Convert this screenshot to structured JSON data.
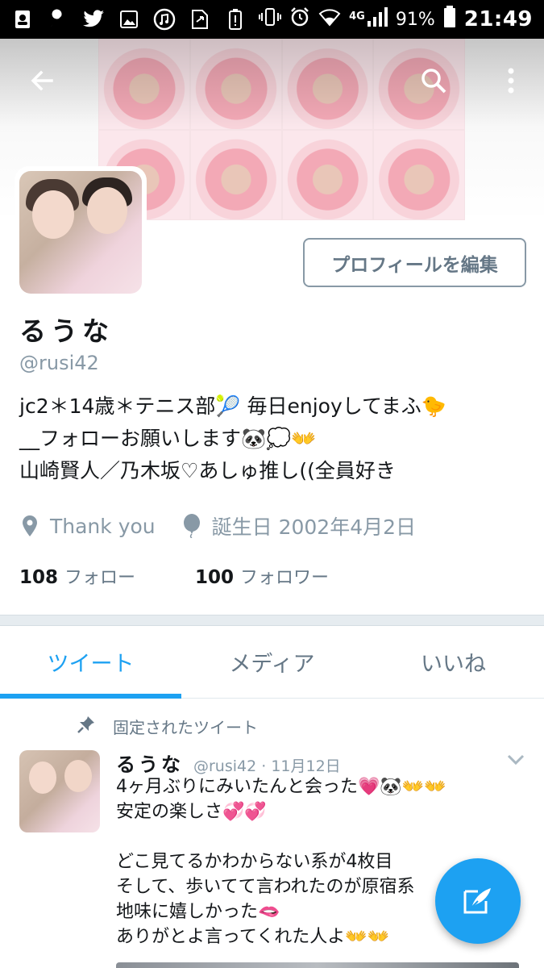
{
  "status_bar": {
    "left_icons": [
      "contacts-icon",
      "wrench-icon",
      "twitter-bird-icon",
      "image-icon",
      "music-icon",
      "file-transfer-icon",
      "battery-alert-icon"
    ],
    "network_label": "4G",
    "battery_percent": "91%",
    "time": "21:49"
  },
  "header": {
    "back_icon": "arrow-back-icon",
    "search_icon": "search-icon",
    "more_icon": "more-vert-icon"
  },
  "profile": {
    "edit_button": "プロフィールを編集",
    "name": "るうな",
    "handle": "@rusi42",
    "bio_lines": [
      "jc2＊14歳＊テニス部🎾 毎日enjoyしてまふ🐤",
      "__フォローお願いします🐼💭👐",
      "山崎賢人／乃木坂♡あしゅ推し((全員好き"
    ],
    "location": "Thank you",
    "birthday": "誕生日 2002年4月2日",
    "following_count": "108",
    "following_label": "フォロー",
    "followers_count": "100",
    "followers_label": "フォロワー"
  },
  "tabs": [
    {
      "label": "ツイート",
      "active": true
    },
    {
      "label": "メディア",
      "active": false
    },
    {
      "label": "いいね",
      "active": false
    }
  ],
  "pinned_tweet": {
    "pinned_label": "固定されたツイート",
    "name": "るうな",
    "meta": "@rusi42 · 11月12日",
    "lines": [
      "4ヶ月ぶりにみいたんと会った💗🐼👐👐",
      "安定の楽しさ💞💞",
      "",
      "どこ見てるかわからない系が4枚目",
      "そして、歩いてて言われたのが原宿系",
      "地味に嬉しかった🫦",
      "ありがとよ言ってくれた人よ👐👐"
    ]
  },
  "fab": {
    "icon": "compose-tweet-icon"
  },
  "colors": {
    "accent": "#1da1f2",
    "muted": "#657786",
    "text": "#14171a"
  }
}
